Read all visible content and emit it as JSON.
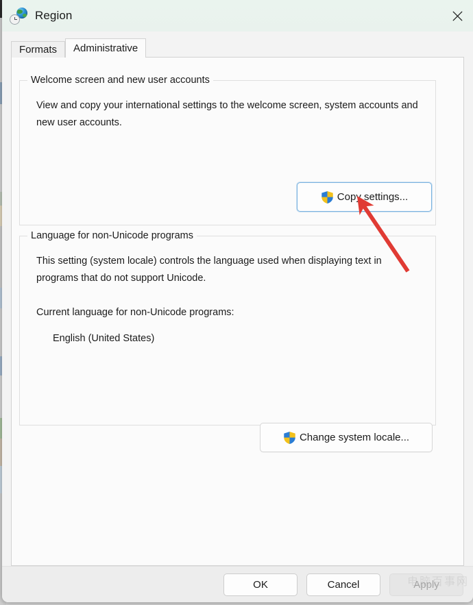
{
  "window": {
    "title": "Region",
    "icon": "region-globe-clock-icon",
    "close_label": "Close",
    "titlebar_color": "#e9f2ed"
  },
  "tabs": [
    {
      "label": "Formats",
      "active": false
    },
    {
      "label": "Administrative",
      "active": true
    }
  ],
  "groups": {
    "welcome": {
      "legend": "Welcome screen and new user accounts",
      "description": "View and copy your international settings to the welcome screen, system accounts and new user accounts.",
      "button": {
        "label": "Copy settings...",
        "icon": "uac-shield-icon",
        "focused": true
      }
    },
    "language": {
      "legend": "Language for non-Unicode programs",
      "description": "This setting (system locale) controls the language used when displaying text in programs that do not support Unicode.",
      "current_label": "Current language for non-Unicode programs:",
      "current_value": "English (United States)",
      "button": {
        "label": "Change system locale...",
        "icon": "uac-shield-icon",
        "focused": false
      }
    }
  },
  "footer": {
    "ok_label": "OK",
    "cancel_label": "Cancel",
    "apply_label": "Apply",
    "apply_disabled": true
  },
  "annotation": {
    "type": "arrow",
    "color": "#e03b34",
    "points_to": "copy-settings-button",
    "from": [
      595,
      396
    ],
    "to": [
      524,
      291
    ]
  },
  "watermark": {
    "text": "电脑百事网"
  }
}
